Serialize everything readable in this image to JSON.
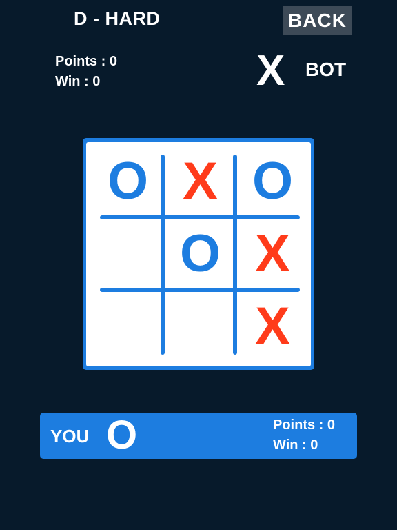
{
  "header": {
    "title": "D - HARD",
    "back_label": "BACK"
  },
  "bot": {
    "points_text": "Points : 0",
    "win_text": "Win : 0",
    "mark": "X",
    "label": "BOT"
  },
  "board": {
    "cells": [
      "O",
      "X",
      "O",
      "",
      "O",
      "X",
      "",
      "",
      "X"
    ]
  },
  "player": {
    "label": "YOU",
    "mark": "O",
    "points_text": "Points : 0",
    "win_text": "Win : 0"
  },
  "colors": {
    "background": "#071a2b",
    "accent_blue": "#1d7de0",
    "x_red": "#ff3b1a",
    "back_button": "#3d4a57"
  }
}
